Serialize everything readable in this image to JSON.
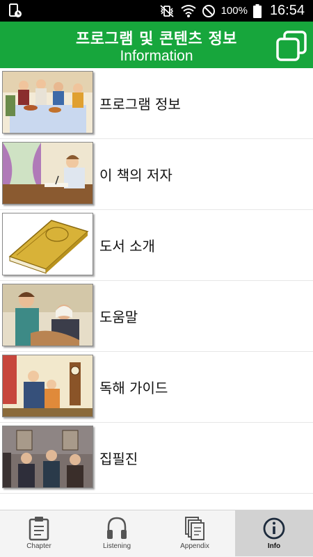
{
  "status_bar": {
    "battery_percent": "100%",
    "time": "16:54",
    "icons": [
      "phone-storage-icon",
      "vibrate-mute-icon",
      "wifi-icon",
      "do-not-disturb-icon",
      "battery-icon"
    ]
  },
  "header": {
    "title_ko": "프로그램 및 콘텐츠 정보",
    "title_en": "Information",
    "window_icon": "multi-window-icon",
    "color": "#17a63c"
  },
  "menu": {
    "items": [
      {
        "label": "프로그램 정보",
        "thumbnail": "family-dinner-illustration"
      },
      {
        "label": "이 책의 저자",
        "thumbnail": "author-writing-illustration"
      },
      {
        "label": "도서 소개",
        "thumbnail": "beauty-book-illustration"
      },
      {
        "label": "도움말",
        "thumbnail": "women-sewing-illustration"
      },
      {
        "label": "독해 가이드",
        "thumbnail": "family-parlor-illustration"
      },
      {
        "label": "집필진",
        "thumbnail": "gentlemen-meeting-illustration"
      }
    ]
  },
  "tabs": [
    {
      "label": "Chapter",
      "icon": "clipboard-icon",
      "active": false
    },
    {
      "label": "Listening",
      "icon": "headphones-icon",
      "active": false
    },
    {
      "label": "Appendix",
      "icon": "stacked-pages-icon",
      "active": false
    },
    {
      "label": "Info",
      "icon": "info-icon",
      "active": true
    }
  ]
}
